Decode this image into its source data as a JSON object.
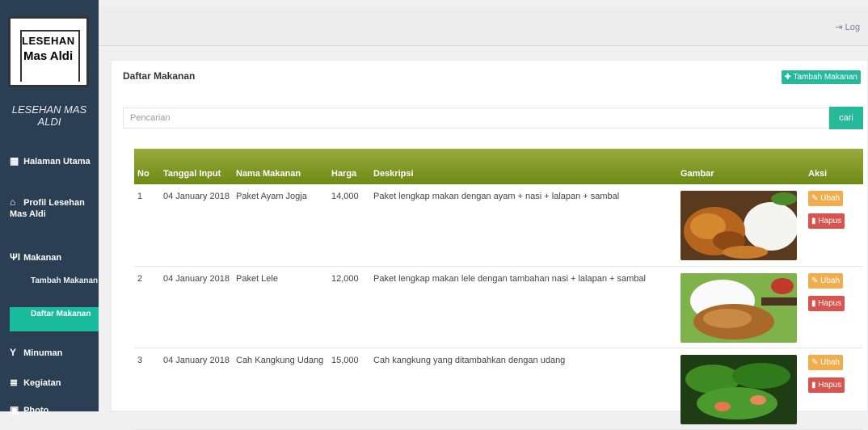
{
  "logo": {
    "line1": "LESEHAN",
    "line2": "Mas Aldi"
  },
  "brand": "LESEHAN MAS ALDI",
  "sidebar": {
    "items": [
      {
        "icon": "grid-icon",
        "label": "Halaman Utama"
      },
      {
        "icon": "home-icon",
        "label": "Profil Lesehan Mas Aldi"
      },
      {
        "icon": "cutlery-icon",
        "label": "Makanan"
      },
      {
        "icon": "glass-icon",
        "label": "Minuman"
      },
      {
        "icon": "list-icon",
        "label": "Kegiatan"
      },
      {
        "icon": "picture-icon",
        "label": "Photo"
      }
    ],
    "submenu": [
      {
        "label": "Tambah Makanan",
        "active": false
      },
      {
        "label": "Daftar Makanan",
        "active": true
      }
    ]
  },
  "topbar": {
    "logout_label": "Log"
  },
  "panel": {
    "title": "Daftar Makanan",
    "add_button": "Tambah Makanan",
    "search_placeholder": "Pencarian",
    "search_button": "cari"
  },
  "table": {
    "headers": [
      "No",
      "Tanggal Input",
      "Nama Makanan",
      "Harga",
      "Deskripsi",
      "Gambar",
      "Aksi"
    ],
    "rows": [
      {
        "no": "1",
        "date": "04 January 2018",
        "name": "Paket Ayam Jogja",
        "price": "14,000",
        "desc": "Paket lengkap makan dengan ayam + nasi + lalapan + sambal"
      },
      {
        "no": "2",
        "date": "04 January 2018",
        "name": "Paket Lele",
        "price": "12,000",
        "desc": "Paket lengkap makan lele dengan tambahan nasi + lalapan + sambal"
      },
      {
        "no": "3",
        "date": "04 January 2018",
        "name": "Cah Kangkung Udang",
        "price": "15,000",
        "desc": "Cah kangkung yang ditambahkan dengan udang"
      }
    ],
    "edit_label": "Ubah",
    "delete_label": "Hapus"
  },
  "colors": {
    "sidebar": "#2a3f54",
    "accent": "#26b99a",
    "header_green": "#7f971f",
    "edit": "#f0ad4e",
    "delete": "#d9534f"
  }
}
